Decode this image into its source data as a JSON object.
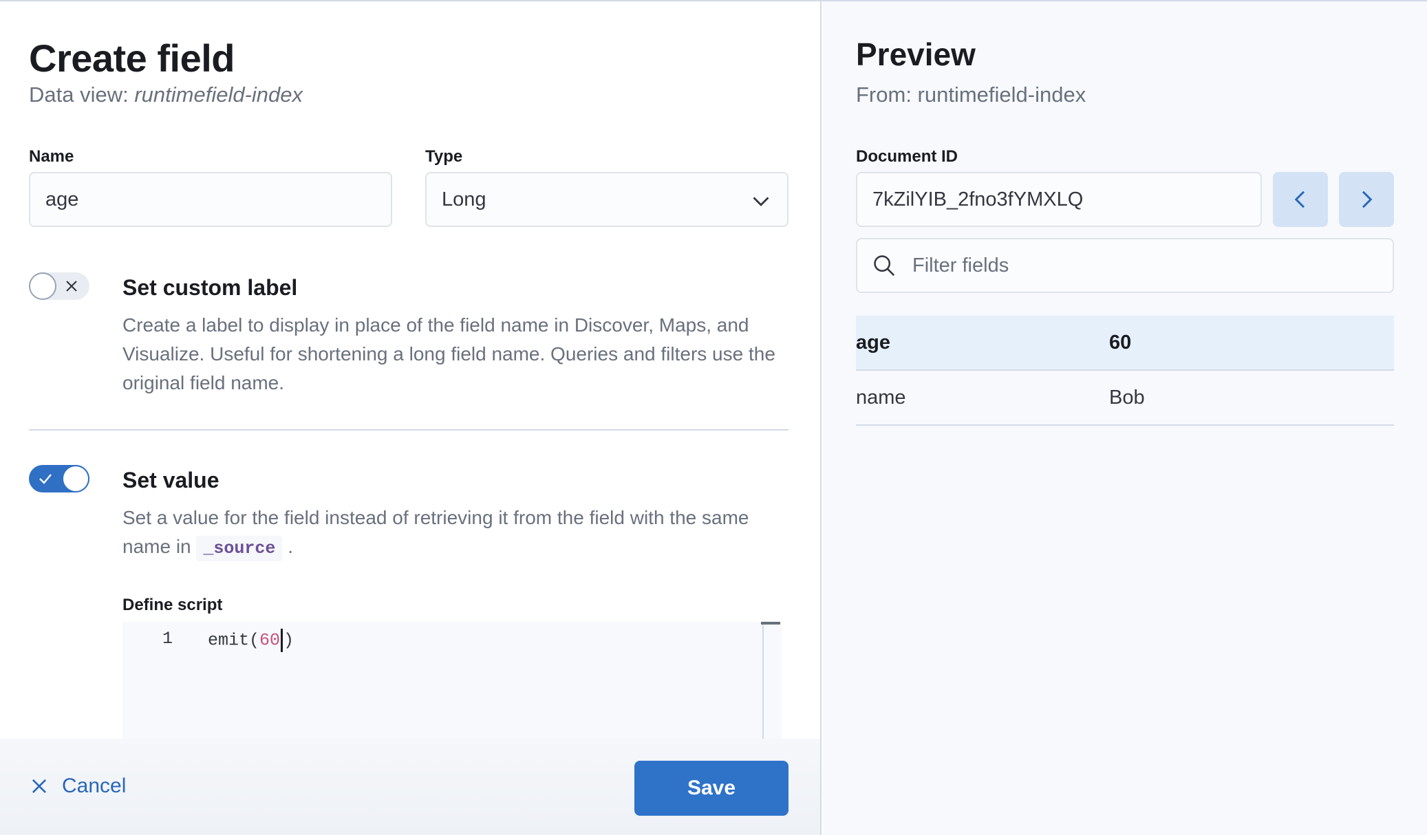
{
  "flyout": {
    "title": "Create field",
    "subtitle_prefix": "Data view: ",
    "subtitle_index": "runtimefield-index"
  },
  "form": {
    "name_label": "Name",
    "name_value": "age",
    "type_label": "Type",
    "type_value": "Long"
  },
  "custom_label": {
    "title": "Set custom label",
    "description": "Create a label to display in place of the field name in Discover, Maps, and Visualize. Useful for shortening a long field name. Queries and filters use the original field name.",
    "enabled": false
  },
  "set_value": {
    "title": "Set value",
    "description_before": "Set a value for the field instead of retrieving it from the field with the same name in ",
    "description_code": "_source",
    "description_after": " .",
    "enabled": true
  },
  "script": {
    "label": "Define script",
    "line_number": "1",
    "code_prefix": "emit(",
    "code_number": "60",
    "code_suffix": ")"
  },
  "footer": {
    "cancel_label": "Cancel",
    "save_label": "Save"
  },
  "preview": {
    "title": "Preview",
    "subtitle": "From: runtimefield-index",
    "doc_id_label": "Document ID",
    "doc_id_value": "7kZilYIB_2fno3fYMXLQ",
    "filter_placeholder": "Filter fields",
    "fields": [
      {
        "name": "age",
        "value": "60"
      },
      {
        "name": "name",
        "value": "Bob"
      }
    ]
  },
  "colors": {
    "primary": "#2f73c9",
    "link": "#2867b8",
    "selected_row": "#e6f0fb"
  }
}
